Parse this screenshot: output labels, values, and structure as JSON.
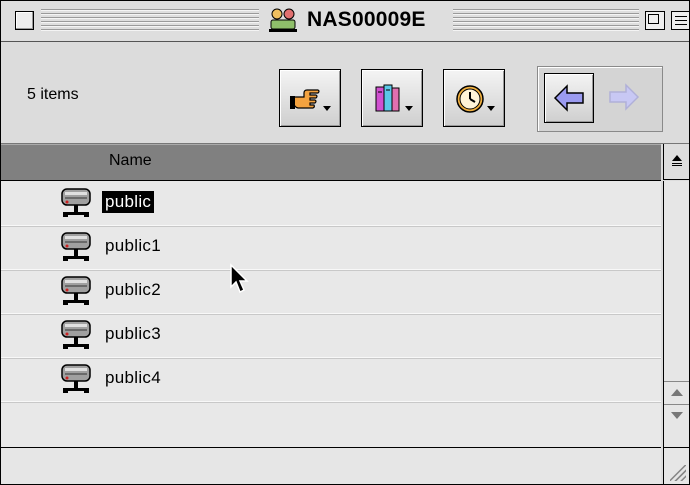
{
  "window": {
    "title": "NAS00009E"
  },
  "toolbar": {
    "items_count": "5 items",
    "buttons": [
      {
        "icon": "pointing-hand-icon"
      },
      {
        "icon": "books-icon"
      },
      {
        "icon": "clock-icon"
      }
    ],
    "nav": {
      "back_icon": "left-arrow-icon",
      "forward_icon": "right-arrow-icon",
      "forward_enabled": false
    }
  },
  "list": {
    "column_header": "Name",
    "rows": [
      {
        "label": "public",
        "selected": true
      },
      {
        "label": "public1",
        "selected": false
      },
      {
        "label": "public2",
        "selected": false
      },
      {
        "label": "public3",
        "selected": false
      },
      {
        "label": "public4",
        "selected": false
      }
    ]
  },
  "colors": {
    "header_bg": "#808080",
    "list_bg": "#e8e8e8",
    "selection": "#000000",
    "nav_arrow": "#9b9bf0"
  }
}
